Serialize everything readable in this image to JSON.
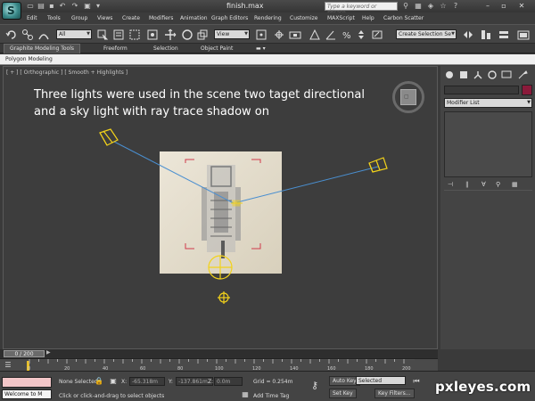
{
  "app": {
    "file_title": "finish.max",
    "logo_letter": "S",
    "search_placeholder": "Type a keyword or phrase"
  },
  "menu": {
    "items": [
      "Edit",
      "Tools",
      "Group",
      "Views",
      "Create",
      "Modifiers",
      "Animation",
      "Graph Editors",
      "Rendering",
      "Customize",
      "MAXScript",
      "Help",
      "Carbon Scatter"
    ]
  },
  "toolbar": {
    "selection_filter": "All",
    "reference_coord": "View",
    "named_selection_placeholder": "Create Selection Se"
  },
  "ribbon": {
    "tabs": [
      "Graphite Modeling Tools",
      "Freeform",
      "Selection",
      "Object Paint"
    ],
    "active_subtab": "Polygon Modeling"
  },
  "viewport": {
    "label": "[ + ] [ Orthographic ] [ Smooth + Highlights ]",
    "caption_line1": "Three lights were used in the scene two taget directional",
    "caption_line2": "and a sky light with ray trace shadow on",
    "colors": {
      "light_gizmo": "#f2d21a",
      "light_ray": "#4a8fd0",
      "selection_bracket": "#d03a4a"
    }
  },
  "command_panel": {
    "modifier_list": "Modifier List",
    "object_color": "#8a1a3a"
  },
  "timeline": {
    "slider_label": "0 / 200",
    "frames": [
      "0",
      "20",
      "40",
      "60",
      "80",
      "100",
      "120",
      "140",
      "160",
      "180",
      "200"
    ]
  },
  "statusbar": {
    "listener_text": "Welcome to M",
    "selection_status": "None Selected",
    "prompt": "Click or click-and-drag to select objects",
    "x_label": "X:",
    "x_value": "-65.318m",
    "y_label": "Y:",
    "y_value": "-137.861m",
    "z_label": "Z:",
    "z_value": "0.0m",
    "grid": "Grid = 0.254m",
    "add_time_tag": "Add Time Tag",
    "auto_key": "Auto Key",
    "set_key": "Set Key",
    "key_mode": "Selected",
    "key_filters": "Key Filters..."
  },
  "watermark": "pxleyes.com"
}
